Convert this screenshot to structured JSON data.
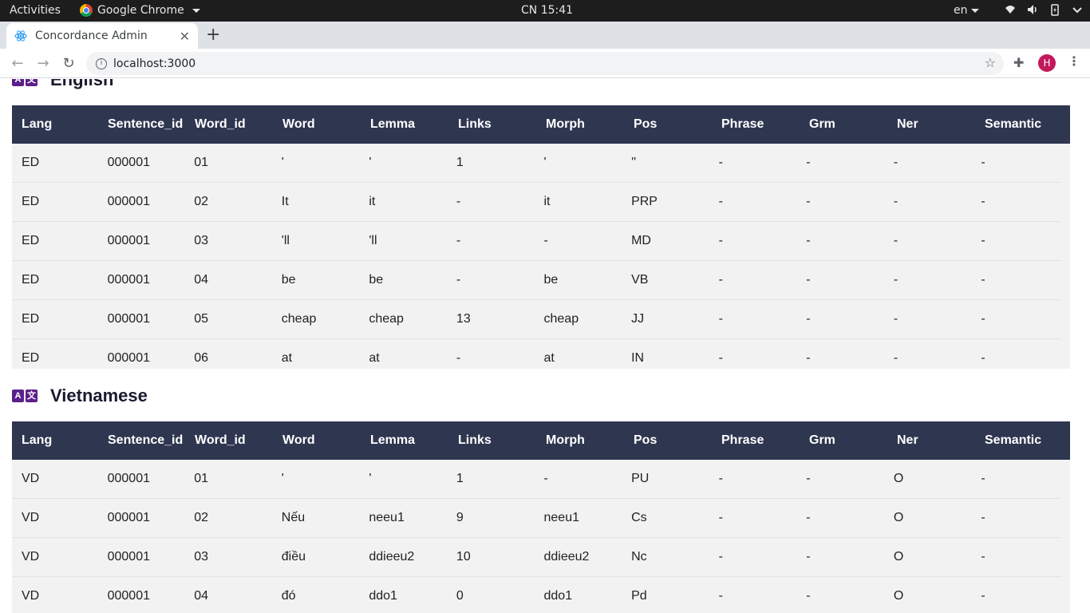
{
  "topbar": {
    "activities": "Activities",
    "app_name": "Google Chrome",
    "clock": "CN 15:41",
    "lang": "en"
  },
  "browser": {
    "tab_title": "Concordance Admin",
    "url": "localhost:3000",
    "avatar_letter": "H"
  },
  "columns": [
    "Lang",
    "Sentence_id",
    "Word_id",
    "Word",
    "Lemma",
    "Links",
    "Morph",
    "Pos",
    "Phrase",
    "Grm",
    "Ner",
    "Semantic"
  ],
  "english": {
    "title": "English",
    "icon_left": "A",
    "icon_right": "文",
    "rows": [
      [
        "ED",
        "000001",
        "01",
        "'",
        "'",
        "1",
        "'",
        "''",
        "-",
        "-",
        "-",
        "-"
      ],
      [
        "ED",
        "000001",
        "02",
        "It",
        "it",
        "-",
        "it",
        "PRP",
        "-",
        "-",
        "-",
        "-"
      ],
      [
        "ED",
        "000001",
        "03",
        "'ll",
        "'ll",
        "-",
        "-",
        "MD",
        "-",
        "-",
        "-",
        "-"
      ],
      [
        "ED",
        "000001",
        "04",
        "be",
        "be",
        "-",
        "be",
        "VB",
        "-",
        "-",
        "-",
        "-"
      ],
      [
        "ED",
        "000001",
        "05",
        "cheap",
        "cheap",
        "13",
        "cheap",
        "JJ",
        "-",
        "-",
        "-",
        "-"
      ],
      [
        "ED",
        "000001",
        "06",
        "at",
        "at",
        "-",
        "at",
        "IN",
        "-",
        "-",
        "-",
        "-"
      ]
    ]
  },
  "vietnamese": {
    "title": "Vietnamese",
    "icon_left": "A",
    "icon_right": "文",
    "rows": [
      [
        "VD",
        "000001",
        "01",
        "'",
        "'",
        "1",
        "-",
        "PU",
        "-",
        "-",
        "O",
        "-"
      ],
      [
        "VD",
        "000001",
        "02",
        "Nếu",
        "neeu1",
        "9",
        "neeu1",
        "Cs",
        "-",
        "-",
        "O",
        "-"
      ],
      [
        "VD",
        "000001",
        "03",
        "điều",
        "ddieeu2",
        "10",
        "ddieeu2",
        "Nc",
        "-",
        "-",
        "O",
        "-"
      ],
      [
        "VD",
        "000001",
        "04",
        "đó",
        "ddo1",
        "0",
        "ddo1",
        "Pd",
        "-",
        "-",
        "O",
        "-"
      ]
    ]
  }
}
